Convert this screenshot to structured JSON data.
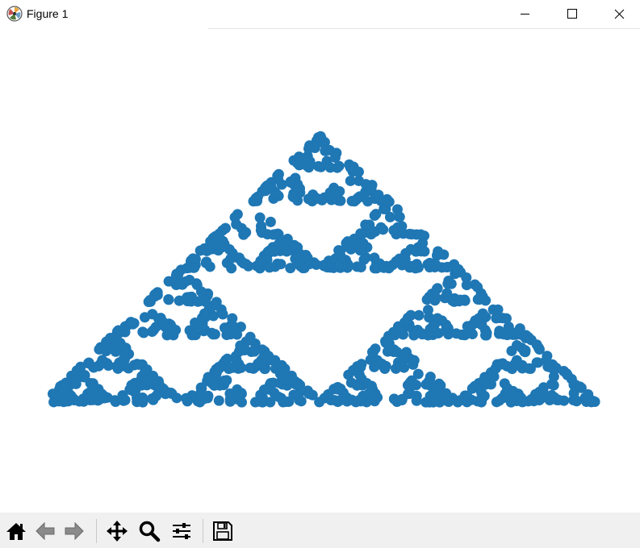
{
  "window": {
    "title": "Figure 1"
  },
  "toolbar": {
    "buttons": [
      "home-icon",
      "back-arrow-icon",
      "forward-arrow-icon",
      "pan-icon",
      "zoom-icon",
      "configure-subplots-icon",
      "save-icon"
    ]
  },
  "colors": {
    "marker": "#1f77b4",
    "toolbar_bg": "#f0f0f0"
  },
  "chart_data": {
    "type": "scatter",
    "title": "",
    "xlabel": "",
    "ylabel": "",
    "axes_visible": false,
    "grid": false,
    "xlim": [
      -0.05,
      1.05
    ],
    "ylim": [
      -0.2,
      1.05
    ],
    "series": [
      {
        "marker_color": "#1f77b4",
        "marker_shape": "circle",
        "generator": "chaos-game",
        "vertices": [
          [
            0,
            0
          ],
          [
            1,
            0
          ],
          [
            0.5,
            0.866
          ]
        ],
        "point_count": 1100
      }
    ]
  }
}
